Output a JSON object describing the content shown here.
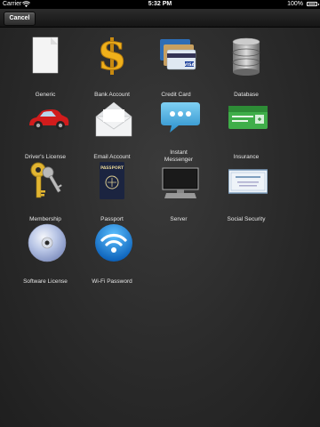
{
  "status_bar": {
    "carrier": "Carrier",
    "time": "5:32 PM",
    "battery_percent": "100%",
    "battery_level": 1.0
  },
  "nav_bar": {
    "cancel_label": "Cancel"
  },
  "items": [
    {
      "label": "Generic",
      "icon": "generic-document-icon"
    },
    {
      "label": "Bank Account",
      "icon": "dollar-sign-icon"
    },
    {
      "label": "Credit Card",
      "icon": "credit-card-icon"
    },
    {
      "label": "Database",
      "icon": "database-icon"
    },
    {
      "label": "Driver's License",
      "icon": "red-car-icon"
    },
    {
      "label": "Email Account",
      "icon": "envelope-icon"
    },
    {
      "label": "Instant Messenger",
      "icon": "chat-bubble-icon"
    },
    {
      "label": "Insurance",
      "icon": "insurance-card-icon"
    },
    {
      "label": "Membership",
      "icon": "keys-icon"
    },
    {
      "label": "Passport",
      "icon": "passport-icon"
    },
    {
      "label": "Server",
      "icon": "computer-icon"
    },
    {
      "label": "Social Security",
      "icon": "certificate-icon"
    },
    {
      "label": "Software License",
      "icon": "disc-icon"
    },
    {
      "label": "Wi-Fi Password",
      "icon": "wifi-icon"
    }
  ]
}
